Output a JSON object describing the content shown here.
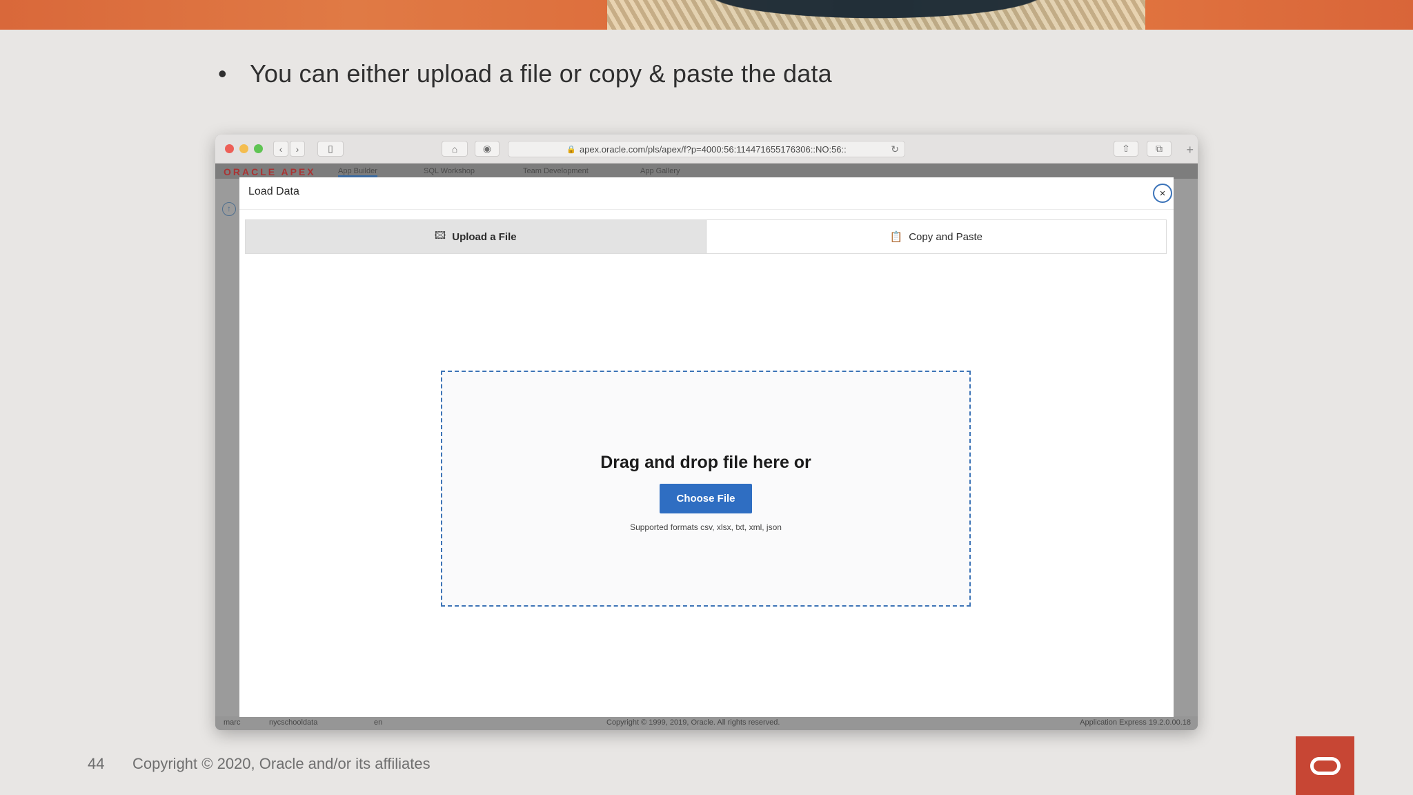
{
  "slide": {
    "bullet_glyph": "•",
    "bullet_text": "You can either upload a file or copy & paste the data",
    "page_number": "44",
    "copyright": "Copyright © 2020, Oracle and/or its affiliates"
  },
  "browser": {
    "url": "apex.oracle.com/pls/apex/f?p=4000:56:114471655176306::NO:56::",
    "lock_glyph": "🔒",
    "reload_glyph": "↻",
    "back_glyph": "‹",
    "forward_glyph": "›",
    "sidebar_glyph": "▯",
    "share_glyph": "⇧",
    "tabs_glyph": "⧉",
    "newtab_glyph": "+"
  },
  "apex_app": {
    "logo": "ORACLE APEX",
    "tabs": [
      "App Builder",
      "SQL Workshop",
      "Team Development",
      "App Gallery"
    ],
    "footer": {
      "user": "marc",
      "schema": "nycschooldata",
      "language": "en",
      "copyright": "Copyright © 1999, 2019, Oracle. All rights reserved.",
      "version": "Application Express 19.2.0.00.18"
    }
  },
  "dialog": {
    "title": "Load Data",
    "close_glyph": "×",
    "tabs": [
      {
        "label": "Upload a File",
        "icon": "image-upload-icon",
        "glyph": "🖾",
        "active": true
      },
      {
        "label": "Copy and Paste",
        "icon": "clipboard-icon",
        "glyph": "📋",
        "active": false
      }
    ],
    "dropzone": {
      "heading": "Drag and drop file here or",
      "button_label": "Choose File",
      "formats_text": "Supported formats csv, xlsx, txt, xml, json"
    }
  },
  "colors": {
    "accent_blue": "#2f6ec2",
    "oracle_red": "#c74634",
    "banner_orange": "#dd6e3c"
  }
}
